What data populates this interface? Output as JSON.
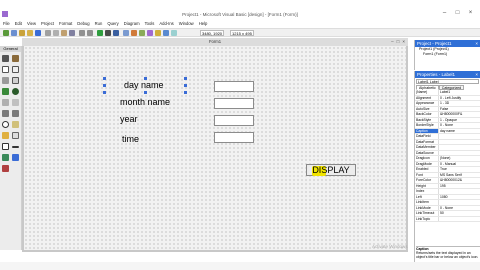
{
  "window": {
    "title": "Project1 - Microsoft Visual Basic [design] - [Form1 (Form)]"
  },
  "menu": [
    "File",
    "Edit",
    "View",
    "Project",
    "Format",
    "Debug",
    "Run",
    "Query",
    "Diagram",
    "Tools",
    "Add-Ins",
    "Window",
    "Help"
  ],
  "toolbar": {
    "position": "3480, 1920",
    "size": "1215 x 495"
  },
  "toolbox": {
    "header": "General"
  },
  "form": {
    "caption": "Form1",
    "labels": [
      "day name",
      "month name",
      "year",
      "time"
    ],
    "button_label": "DISPLAY"
  },
  "project_panel": {
    "title": "Project - Project1",
    "items": [
      "Project1 (Project1)",
      "Form1 (Form1)"
    ]
  },
  "properties_panel": {
    "title": "Properties - Label1",
    "object": "Label1  Label",
    "tabs": [
      "Alphabetic",
      "Categorized"
    ],
    "rows": [
      [
        "(Name)",
        "Label1"
      ],
      [
        "Alignment",
        "0 - Left Justify"
      ],
      [
        "Appearance",
        "1 - 3D"
      ],
      [
        "AutoSize",
        "False"
      ],
      [
        "BackColor",
        "&H8000000F&"
      ],
      [
        "BackStyle",
        "1 - Opaque"
      ],
      [
        "BorderStyle",
        "0 - None"
      ],
      [
        "Caption",
        "day name"
      ],
      [
        "DataField",
        ""
      ],
      [
        "DataFormat",
        ""
      ],
      [
        "DataMember",
        ""
      ],
      [
        "DataSource",
        ""
      ],
      [
        "DragIcon",
        "(None)"
      ],
      [
        "DragMode",
        "0 - Manual"
      ],
      [
        "Enabled",
        "True"
      ],
      [
        "Font",
        "MS Sans Serif"
      ],
      [
        "ForeColor",
        "&H80000012&"
      ],
      [
        "Height",
        "195"
      ],
      [
        "Index",
        ""
      ],
      [
        "Left",
        "1080"
      ],
      [
        "LinkItem",
        ""
      ],
      [
        "LinkMode",
        "0 - None"
      ],
      [
        "LinkTimeout",
        "50"
      ],
      [
        "LinkTopic",
        ""
      ]
    ],
    "desc_title": "Caption",
    "desc_text": "Returns/sets the text displayed in an object's title bar or below an object's icon."
  },
  "watermark": "Activate Windows",
  "colors": {
    "accent": "#2f6fd6",
    "highlight": "#f1e400"
  }
}
